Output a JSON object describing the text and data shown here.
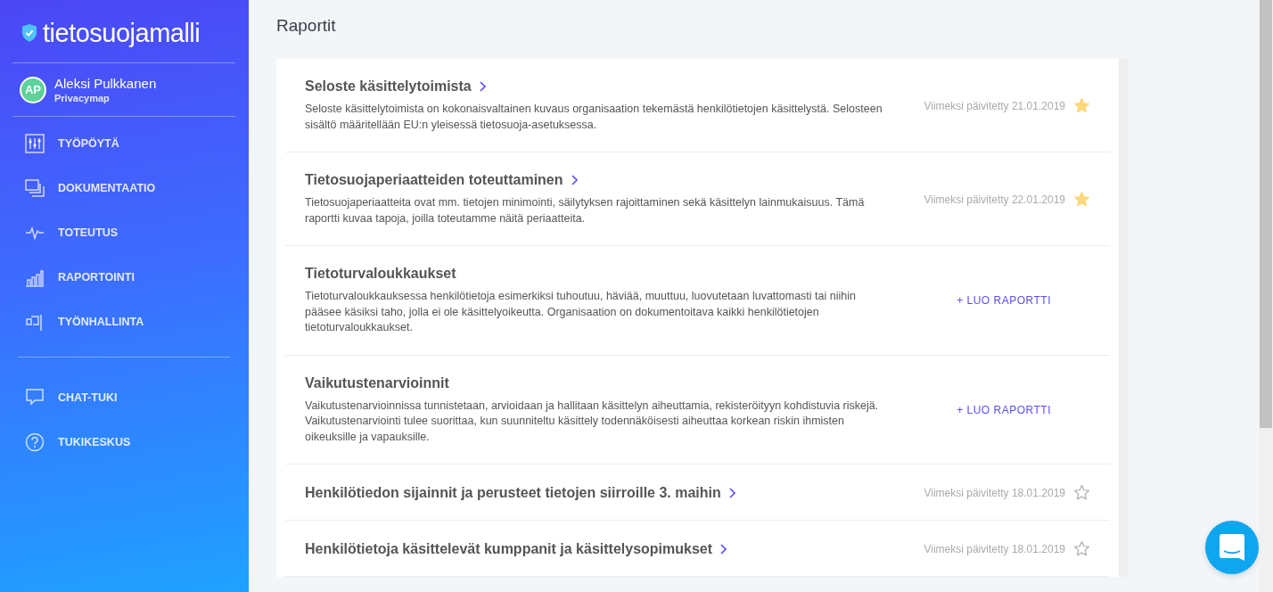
{
  "sidebar": {
    "logo": "tietosuojamalli",
    "user": {
      "initials": "AP",
      "name": "Aleksi Pulkkanen",
      "organization": "Privacymap"
    },
    "nav_items": [
      {
        "label": "TYÖPÖYTÄ"
      },
      {
        "label": "DOKUMENTAATIO"
      },
      {
        "label": "TOTEUTUS"
      },
      {
        "label": "RAPORTOINTI"
      },
      {
        "label": "TYÖNHALLINTA"
      }
    ],
    "support_items": [
      {
        "label": "CHAT-TUKI"
      },
      {
        "label": "TUKIKESKUS"
      }
    ]
  },
  "page_title": "Raportit",
  "reports": [
    {
      "kind": "link",
      "title": "Seloste käsittelytoimista",
      "description": "Seloste käsittelytoimista on kokonaisvaltainen kuvaus organisaation tekemästä henkilötietojen käsittelystä. Selosteen sisältö määritellään EU:n yleisessä tietosuoja-asetuksessa.",
      "updated": "Viimeksi päivitetty 21.01.2019",
      "starred": true
    },
    {
      "kind": "link",
      "title": "Tietosuojaperiaatteiden toteuttaminen",
      "description": "Tietosuojaperiaatteita ovat mm. tietojen minimointi, säilytyksen rajoittaminen sekä käsittelyn lainmukaisuus. Tämä raportti kuvaa tapoja, joilla toteutamme näitä periaatteita.",
      "updated": "Viimeksi päivitetty 22.01.2019",
      "starred": true
    },
    {
      "kind": "create",
      "title": "Tietoturvaloukkaukset",
      "description": "Tietoturvaloukkauksessa henkilötietoja esimerkiksi tuhoutuu, häviää, muuttuu, luovutetaan luvattomasti tai niihin pääsee käsiksi taho, jolla ei ole käsittelyoikeutta. Organisaation on dokumentoitava kaikki henkilötietojen tietoturvaloukkaukset.",
      "action": "+ LUO RAPORTTI"
    },
    {
      "kind": "create",
      "title": "Vaikutustenarvioinnit",
      "description": "Vaikutustenarvioinnissa tunnistetaan, arvioidaan ja hallitaan käsittelyn aiheuttamia, rekisteröityyn kohdistuvia riskejä. Vaikutustenarviointi tulee suorittaa, kun suunniteltu käsittely todennäköisesti aiheuttaa korkean riskin ihmisten oikeuksille ja vapauksille.",
      "action": "+ LUO RAPORTTI"
    },
    {
      "kind": "link",
      "title": "Henkilötiedon sijainnit ja perusteet tietojen siirroille 3. maihin",
      "updated": "Viimeksi päivitetty 18.01.2019",
      "starred": false
    },
    {
      "kind": "link",
      "title": "Henkilötietoja käsittelevät kumppanit ja käsittelysopimukset",
      "updated": "Viimeksi päivitetty 18.01.2019",
      "starred": false
    }
  ]
}
